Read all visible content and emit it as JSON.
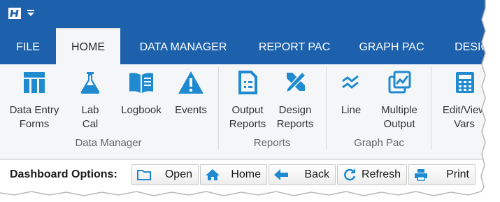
{
  "app": {
    "logo_letter": "H",
    "quick_access_icon": "chevron-down-icon"
  },
  "tabs": [
    {
      "label": "FILE",
      "active": false
    },
    {
      "label": "HOME",
      "active": true
    },
    {
      "label": "DATA MANAGER",
      "active": false
    },
    {
      "label": "REPORT PAC",
      "active": false
    },
    {
      "label": "GRAPH PAC",
      "active": false
    },
    {
      "label": "DESIG",
      "active": false
    }
  ],
  "ribbon": {
    "buttons": [
      {
        "label": "Data Entry\nForms",
        "icon": "table-icon"
      },
      {
        "label": "Lab\nCal",
        "icon": "flask-icon"
      },
      {
        "label": "Logbook",
        "icon": "book-icon"
      },
      {
        "label": "Events",
        "icon": "warning-icon"
      },
      {
        "label": "Output\nReports",
        "icon": "report-icon"
      },
      {
        "label": "Design\nReports",
        "icon": "design-tools-icon"
      },
      {
        "label": "Line",
        "icon": "line-chart-icon"
      },
      {
        "label": "Multiple\nOutput",
        "icon": "multiple-chart-icon"
      },
      {
        "label": "Edit/View\nVars",
        "icon": "calculator-icon"
      }
    ],
    "groups": [
      {
        "label": "Data Manager"
      },
      {
        "label": "Reports"
      },
      {
        "label": "Graph Pac"
      }
    ]
  },
  "dashboard": {
    "label": "Dashboard Options:",
    "buttons": [
      {
        "label": "Open",
        "icon": "folder-icon"
      },
      {
        "label": "Home",
        "icon": "home-icon"
      },
      {
        "label": "Back",
        "icon": "back-arrow-icon"
      },
      {
        "label": "Refresh",
        "icon": "refresh-icon"
      },
      {
        "label": "Print",
        "icon": "printer-icon"
      }
    ]
  },
  "colors": {
    "title_bar": "#1d61ad",
    "ribbon_bg": "#f5f6f7",
    "icon_blue": "#1f8ad0"
  }
}
